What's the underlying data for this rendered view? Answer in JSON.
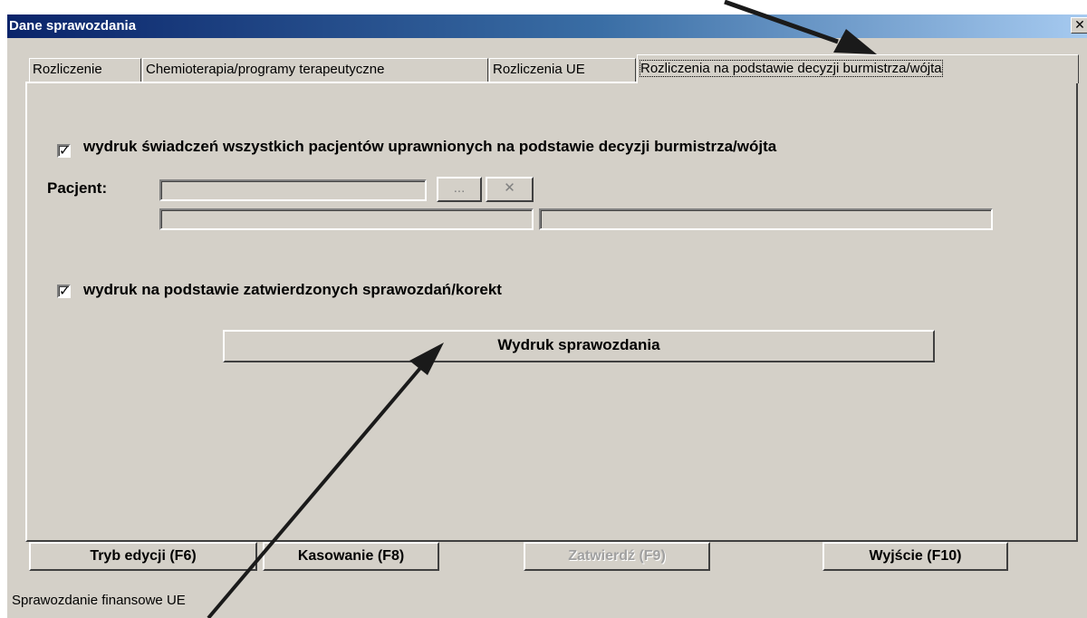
{
  "window": {
    "title": "Dane sprawozdania",
    "close_glyph": "✕"
  },
  "tabs": [
    {
      "label": "Rozliczenie"
    },
    {
      "label": "Chemioterapia/programy terapeutyczne"
    },
    {
      "label": "Rozliczenia UE"
    },
    {
      "label": "Rozliczenia na podstawie decyzji burmistrza/wójta",
      "active": true
    }
  ],
  "panel": {
    "checkbox_all_patients": {
      "label": "wydruk świadczeń wszystkich pacjentów uprawnionych na podstawie decyzji burmistrza/wójta",
      "checked": true
    },
    "patient": {
      "label": "Pacjent:",
      "field_value": "",
      "browse_label": "...",
      "clear_label": "✕",
      "subfield_1": "",
      "subfield_2": ""
    },
    "checkbox_confirmed": {
      "label": "wydruk na podstawie zatwierdzonych sprawozdań/korekt",
      "checked": true
    },
    "print_button": "Wydruk sprawozdania"
  },
  "buttons": {
    "edit": "Tryb edycji (F6)",
    "delete": "Kasowanie (F8)",
    "confirm": "Zatwierdź (F9)",
    "exit": "Wyjście (F10)"
  },
  "status_bar": {
    "text": "Sprawozdanie finansowe UE"
  },
  "colors": {
    "title_gradient_start": "#0a246a",
    "title_gradient_end": "#a6caf0",
    "face": "#d4d0c8",
    "annotation_arrow": "#1a1a1a"
  }
}
